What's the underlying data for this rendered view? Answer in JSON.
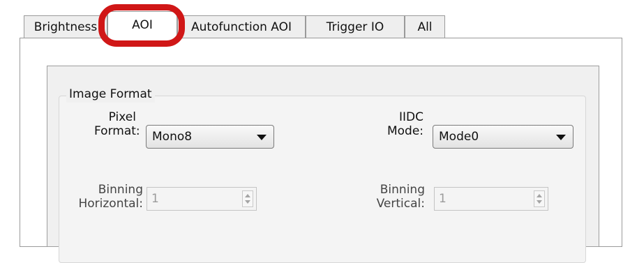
{
  "tabs": [
    {
      "label": "Brightness",
      "active": false
    },
    {
      "label": "AOI",
      "active": true
    },
    {
      "label": "Autofunction AOI",
      "active": false
    },
    {
      "label": "Trigger IO",
      "active": false
    },
    {
      "label": "All",
      "active": false
    }
  ],
  "highlight_color": "#d01717",
  "image_format": {
    "title": "Image Format",
    "pixel_format": {
      "label_line1": "Pixel",
      "label_line2": "Format:",
      "value": "Mono8"
    },
    "iidc_mode": {
      "label_line1": "IIDC",
      "label_line2": "Mode:",
      "value": "Mode0"
    },
    "binning_horizontal": {
      "label_line1": "Binning",
      "label_line2": "Horizontal:",
      "value": "1",
      "enabled": false
    },
    "binning_vertical": {
      "label_line1": "Binning",
      "label_line2": "Vertical:",
      "value": "1",
      "enabled": false
    }
  }
}
